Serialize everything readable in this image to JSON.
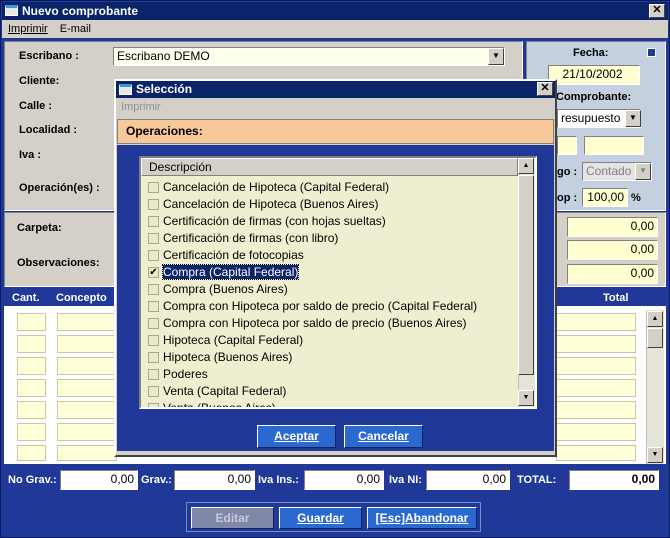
{
  "window": {
    "title": "Nuevo comprobante"
  },
  "menu": {
    "items": [
      "Imprimir",
      "E-mail"
    ]
  },
  "form": {
    "escribano_label": "Escribano :",
    "escribano_value": "Escribano DEMO",
    "cliente_label": "Cliente:",
    "calle_label": "Calle :",
    "localidad_label": "Localidad :",
    "iva_label": "Iva :",
    "operaciones_label": "Operación(es) :",
    "fecha_label": "Fecha:",
    "fecha_value": "21/10/2002",
    "comprobante_label": "Comprobante:",
    "comprobante_value": "resupuesto",
    "pago_label": "go :",
    "pago_value": "Contado",
    "op_label": "op :",
    "op_value": "100,00",
    "op_unit": "%",
    "carpeta_label": "Carpeta:",
    "observaciones_label": "Observaciones:",
    "right_values": [
      "0,00",
      "0,00",
      "0,00"
    ]
  },
  "table": {
    "cant_header": "Cant.",
    "concepto_header": "Concepto",
    "total_header": "Total"
  },
  "totals": {
    "no_grav_label": "No Grav.:",
    "no_grav_value": "0,00",
    "grav_label": "Grav.:",
    "grav_value": "0,00",
    "iva_ins_label": "Iva Ins.:",
    "iva_ins_value": "0,00",
    "iva_ni_label": "Iva NI:",
    "iva_ni_value": "0,00",
    "total_label": "TOTAL:",
    "total_value": "0,00"
  },
  "footer": {
    "editar": "Editar",
    "guardar": "Guardar",
    "abandonar": "[Esc]Abandonar"
  },
  "dialog": {
    "title": "Selección",
    "menu": "Imprimir",
    "heading": "Operaciones:",
    "column": "Descripción",
    "items": [
      {
        "label": "Cancelación de Hipoteca (Capital Federal)",
        "checked": false
      },
      {
        "label": "Cancelación de Hipoteca (Buenos Aires)",
        "checked": false
      },
      {
        "label": "Certificación de firmas (con hojas sueltas)",
        "checked": false
      },
      {
        "label": "Certificación de firmas (con libro)",
        "checked": false
      },
      {
        "label": "Certificación de fotocopias",
        "checked": false
      },
      {
        "label": "Compra (Capital Federal)",
        "checked": true,
        "selected": true
      },
      {
        "label": "Compra (Buenos Aires)",
        "checked": false
      },
      {
        "label": "Compra con Hipoteca por saldo de precio (Capital Federal)",
        "checked": false
      },
      {
        "label": "Compra con Hipoteca por saldo de precio (Buenos Aires)",
        "checked": false
      },
      {
        "label": "Hipoteca (Capital Federal)",
        "checked": false
      },
      {
        "label": "Hipoteca (Buenos Aires)",
        "checked": false
      },
      {
        "label": "Poderes",
        "checked": false
      },
      {
        "label": "Venta (Capital Federal)",
        "checked": false
      },
      {
        "label": "Venta (Buenos Aires)",
        "checked": false
      }
    ],
    "accept": "Aceptar",
    "cancel": "Cancelar"
  },
  "colors": {
    "blue": "#203898",
    "titlebar": "#0a246a",
    "yellow": "#ffffd0",
    "orange": "#f7c89a"
  }
}
